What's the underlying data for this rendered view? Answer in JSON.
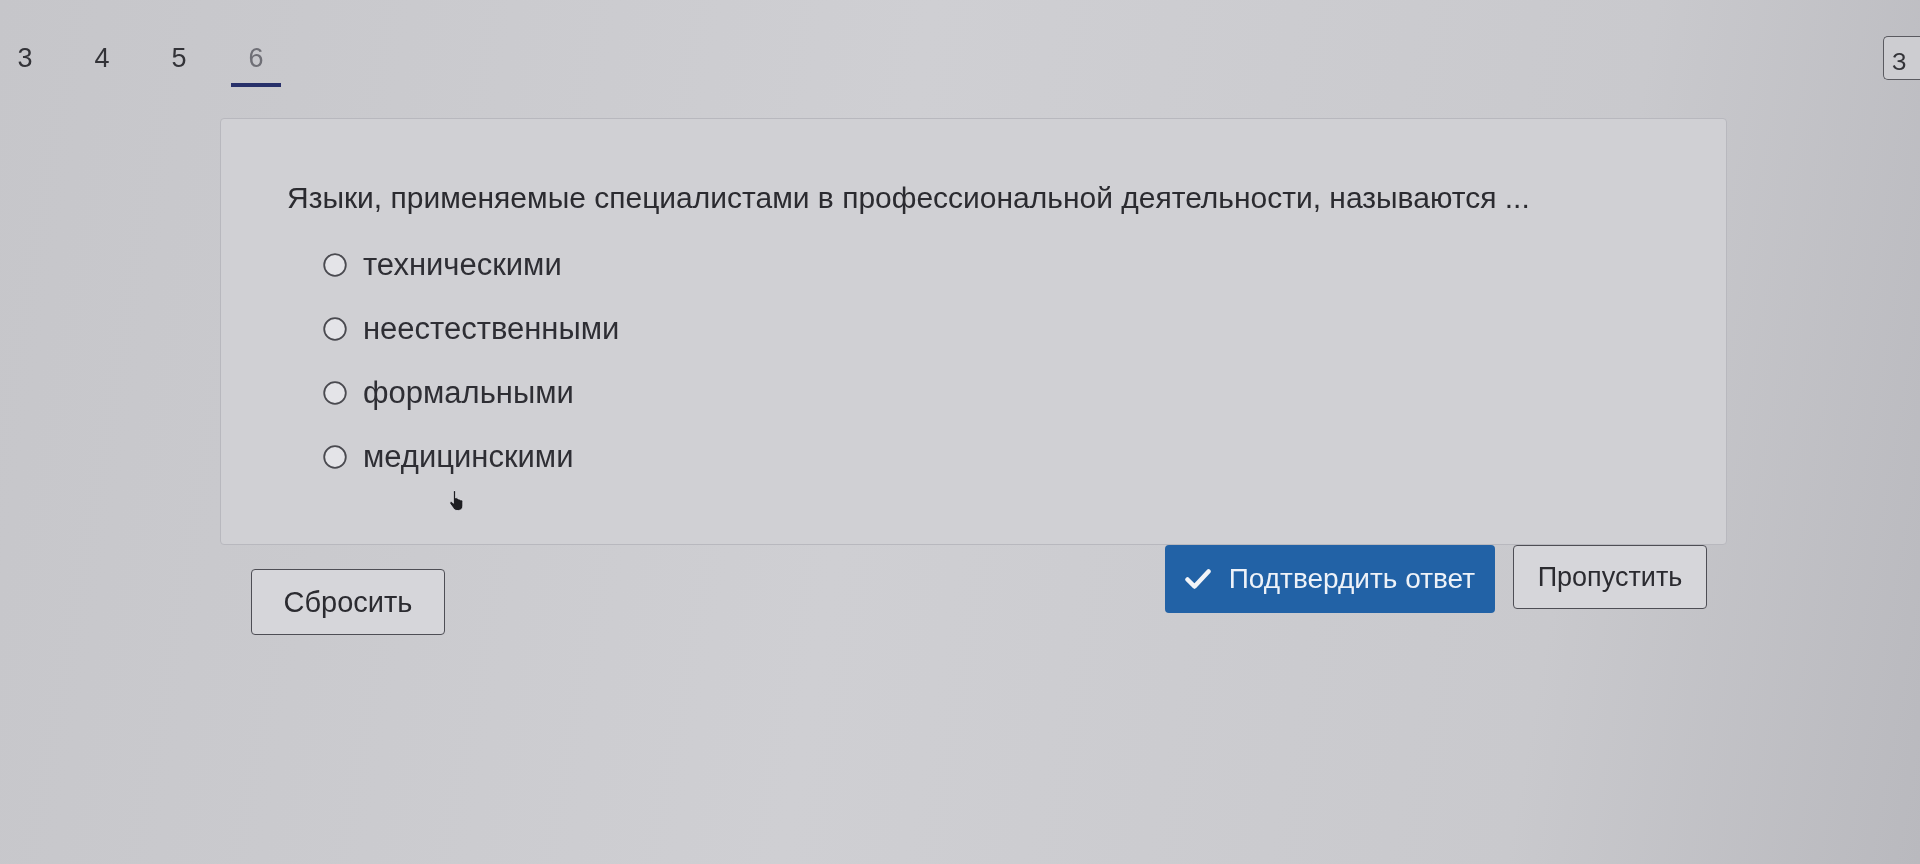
{
  "tabs": [
    {
      "label": "3",
      "selected": false
    },
    {
      "label": "4",
      "selected": false
    },
    {
      "label": "5",
      "selected": false
    },
    {
      "label": "6",
      "selected": true
    }
  ],
  "corner_button": {
    "label": "З"
  },
  "question": {
    "text": "Языки, применяемые специалистами в профессиональной деятельности, называются ...",
    "options": [
      {
        "label": "техническими",
        "selected": false
      },
      {
        "label": "неестественными",
        "selected": false
      },
      {
        "label": "формальными",
        "selected": false
      },
      {
        "label": "медицинскими",
        "selected": false
      }
    ]
  },
  "reset_button": {
    "label": "Сбросить"
  },
  "submit_button": {
    "label": "Подтвердить ответ"
  },
  "skip_button": {
    "label": "Пропустить"
  }
}
